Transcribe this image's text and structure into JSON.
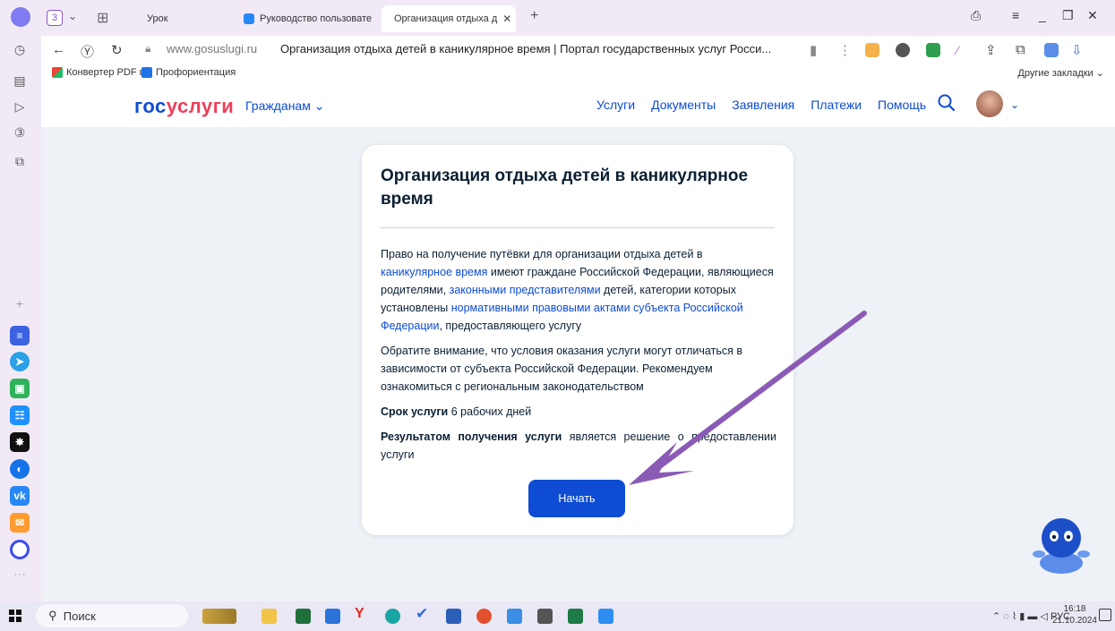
{
  "browser": {
    "tab_count": "3",
    "tabs": [
      {
        "label": "Урок"
      },
      {
        "label": "Руководство пользовате"
      },
      {
        "label": "Организация отдыха д"
      }
    ],
    "url": "www.gosuslugi.ru",
    "page_title": "Организация отдыха детей в каникулярное время | Портал государственных услуг Росси...",
    "bookmarks": [
      {
        "label": "Конвертер PDF в"
      },
      {
        "label": "Профориентация"
      }
    ],
    "other_bookmarks": "Другие закладки"
  },
  "site": {
    "logo_part1": "гос",
    "logo_part2": "услуги",
    "citizens_menu": "Гражданам",
    "nav": [
      "Услуги",
      "Документы",
      "Заявления",
      "Платежи",
      "Помощь"
    ]
  },
  "card": {
    "title": "Организация отдыха детей в каникулярное время",
    "p1": {
      "t1": "Право на получение путёвки для организации отдыха детей в ",
      "link1": "каникулярное время",
      "t2": " имеют граждане Российской Федерации, являющиеся родителями, ",
      "link2": "законными представителями",
      "t3": " детей, категории которых установлены ",
      "link3": "нормативными правовыми актами субъекта Российской Федерации",
      "t4": ", предоставляющего услугу"
    },
    "p2": "Обратите внимание, что условия оказания услуги могут отличаться в зависимости от субъекта Российской Федерации. Рекомендуем ознакомиться с региональным законодательством",
    "p3": {
      "bold": "Срок услуги",
      "text": " 6 рабочих дней"
    },
    "p4": {
      "bold": "Результатом получения услуги",
      "text": " является решение о предоставлении услуги"
    },
    "start_button": "Начать"
  },
  "taskbar": {
    "search_label": "Поиск",
    "lang": "РУС",
    "time": "16:18",
    "date": "21.10.2024"
  },
  "colors": {
    "accent": "#0d4cd3",
    "logo_red": "#ee3f58",
    "page_bg": "#eef2f7",
    "arrow": "#8a5bb5"
  }
}
